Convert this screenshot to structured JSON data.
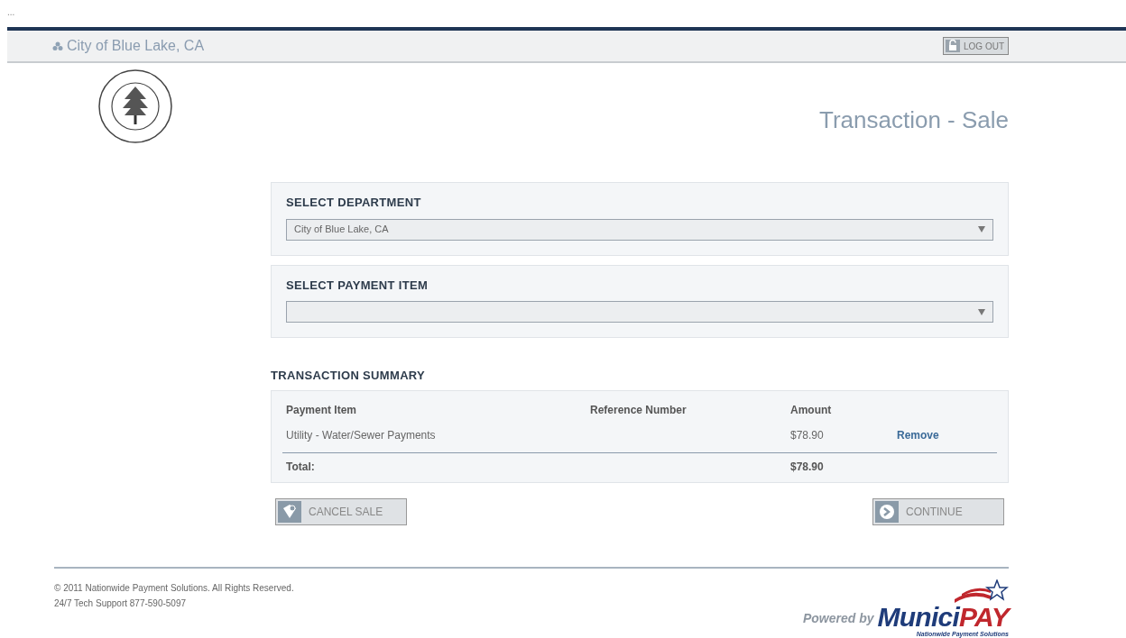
{
  "corner_mark": "...",
  "header": {
    "site_name": "City of Blue Lake, CA",
    "logout_label": "LOG OUT"
  },
  "page_title": "Transaction - Sale",
  "selects": [
    {
      "label": "SELECT DEPARTMENT",
      "value": "City of Blue Lake, CA"
    },
    {
      "label": "SELECT PAYMENT ITEM"
    }
  ],
  "summary": {
    "title": "TRANSACTION SUMMARY",
    "columns": [
      "Payment Item",
      "Reference Number",
      "Amount"
    ],
    "rows": [
      {
        "item": "Utility - Water/Sewer Payments",
        "amount": "$78.90",
        "action": "Remove"
      }
    ],
    "total_label": "Total:",
    "total_amount": "$78.90"
  },
  "buttons": {
    "cancel": "CANCEL SALE",
    "continue": "CONTINUE"
  },
  "footer": {
    "copyright": "© 2011 Nationwide Payment Solutions. All Rights Reserved.",
    "support": "24/7 Tech Support 877-590-5097"
  },
  "powered_logo": {
    "prefix": "Powered by",
    "brand_main": "Munici",
    "brand_accent": "PAY",
    "tagline": "Nationwide Payment Solutions"
  }
}
